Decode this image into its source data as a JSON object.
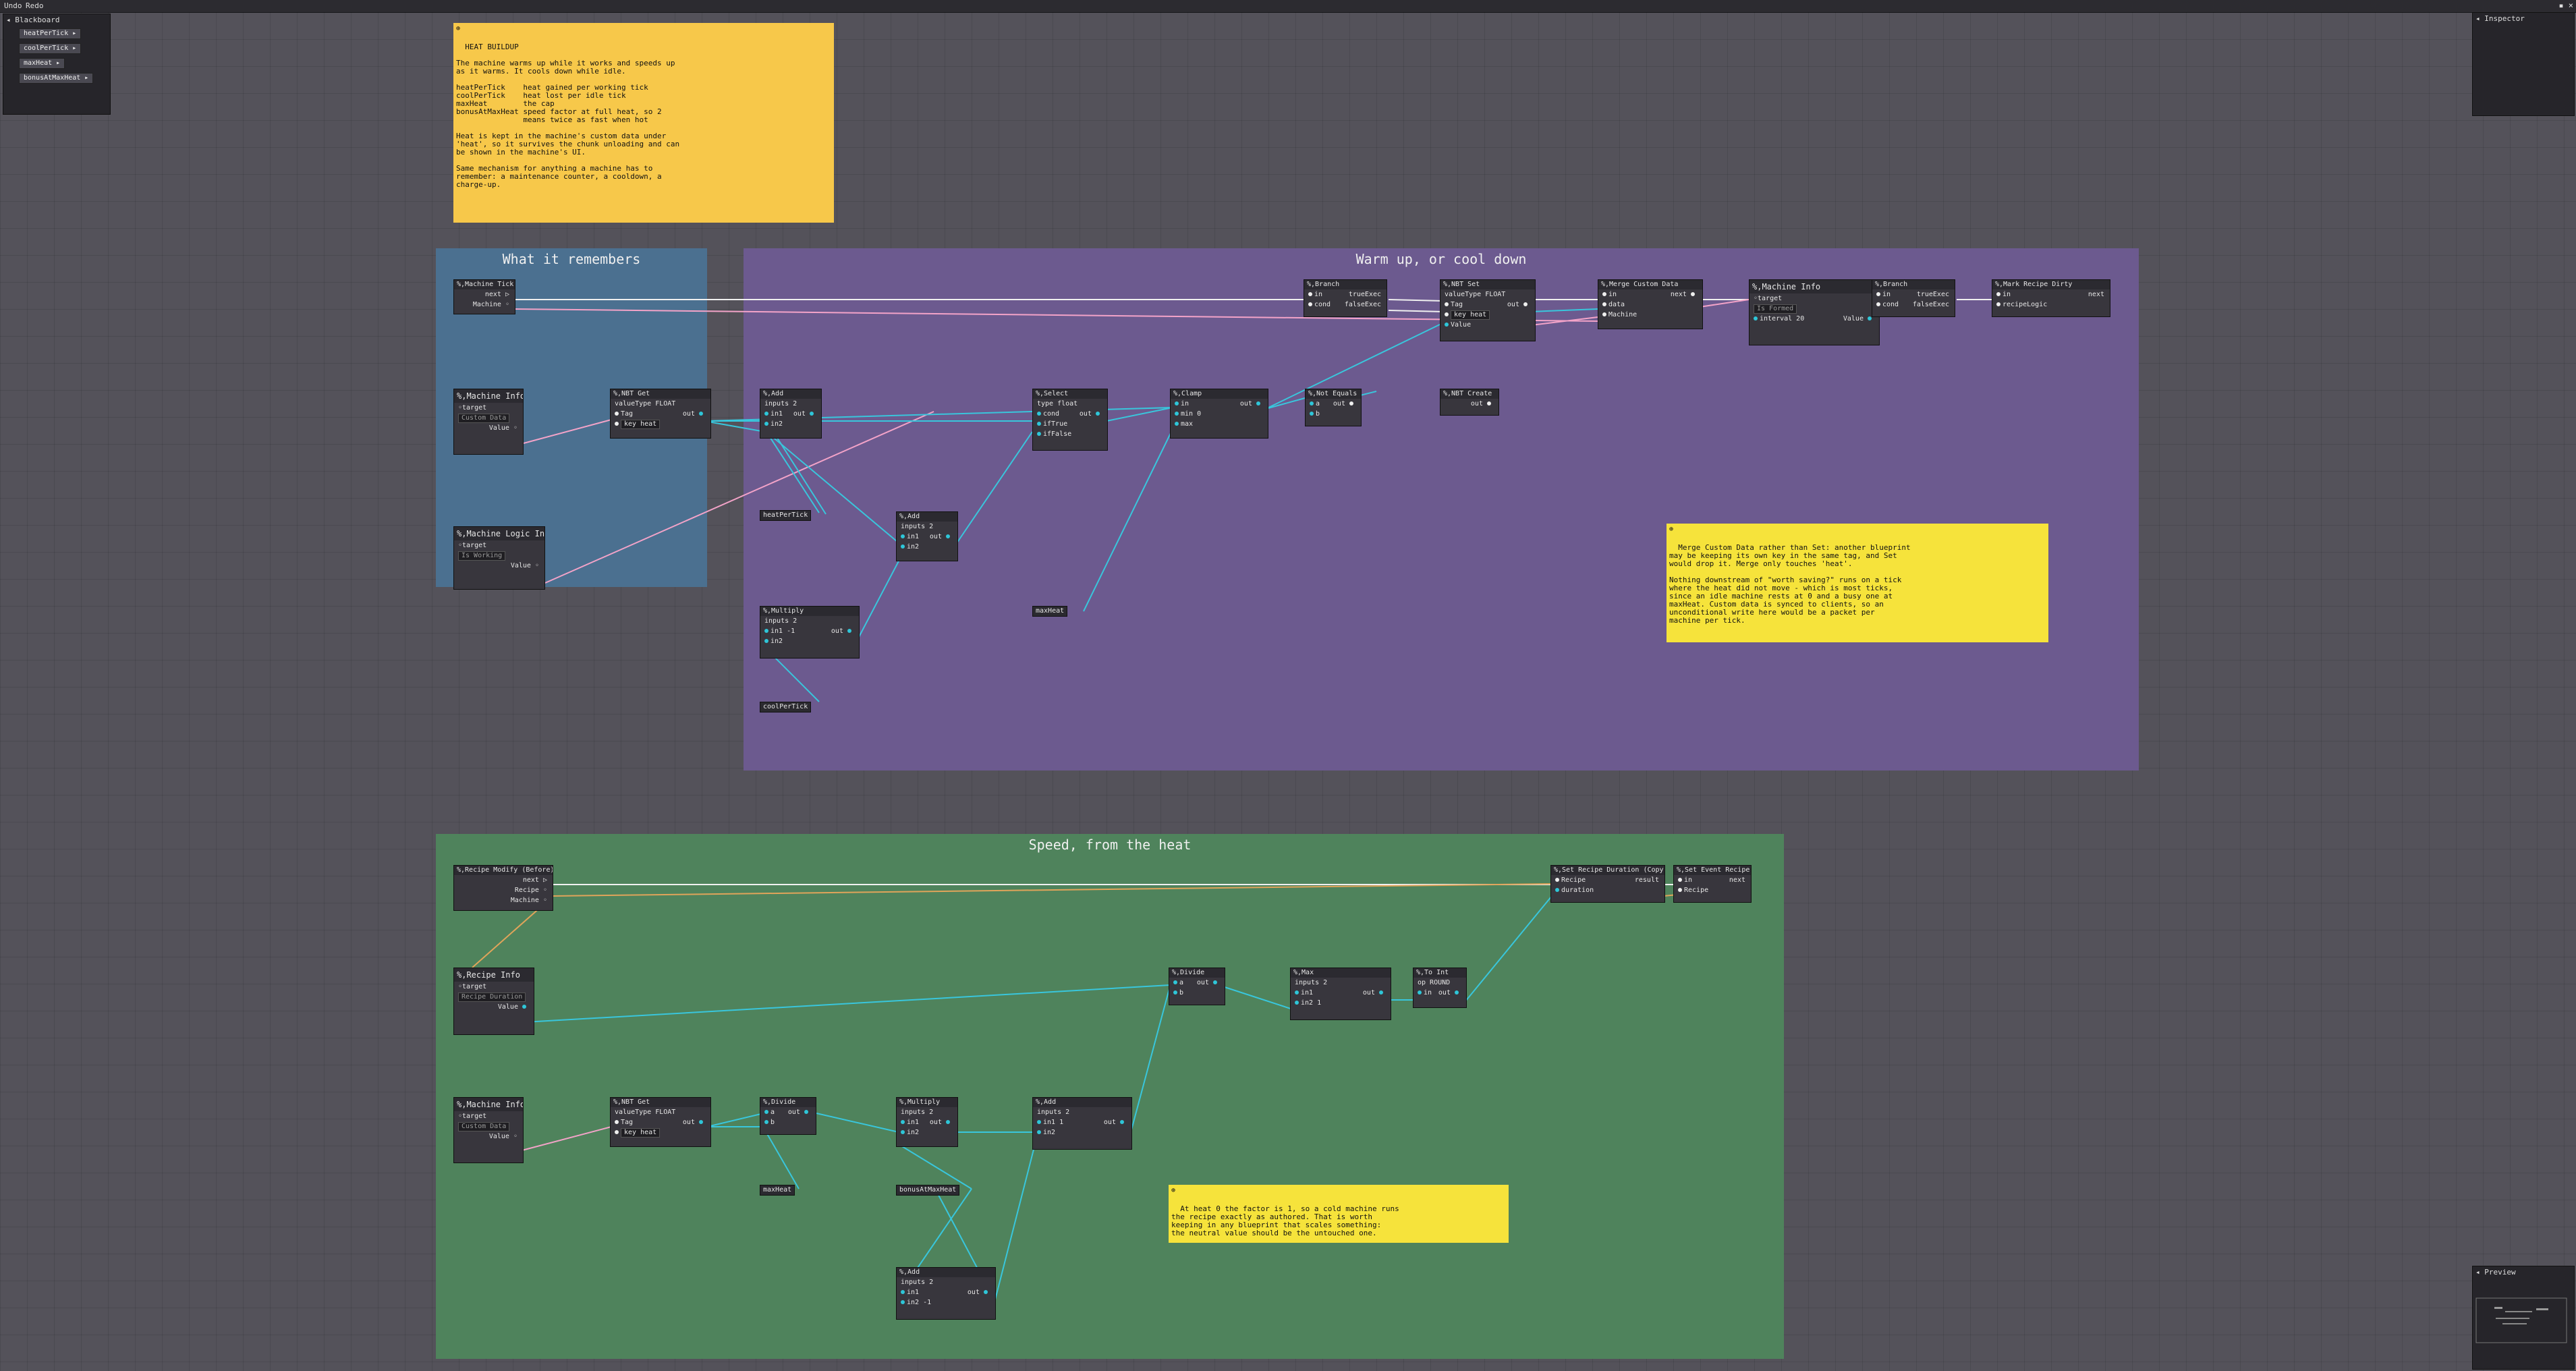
{
  "menu": {
    "undo": "Undo",
    "redo": "Redo"
  },
  "window": {
    "controls": "▪ ×"
  },
  "blackboard": {
    "title": "◂ Blackboard",
    "vars": [
      "heatPerTick ▸",
      "coolPerTick ▸",
      "maxHeat ▸",
      "bonusAtMaxHeat ▸"
    ]
  },
  "inspector": {
    "title": "◂ Inspector"
  },
  "preview": {
    "title": "◂ Preview"
  },
  "groups": {
    "remember": "What it remembers",
    "warm": "Warm up, or cool down",
    "speed": "Speed, from the heat"
  },
  "notes": {
    "heat": "HEAT BUILDUP\n\nThe machine warms up while it works and speeds up\nas it warms. It cools down while idle.\n\nheatPerTick    heat gained per working tick\ncoolPerTick    heat lost per idle tick\nmaxHeat        the cap\nbonusAtMaxHeat speed factor at full heat, so 2\n               means twice as fast when hot\n\nHeat is kept in the machine's custom data under\n'heat', so it survives the chunk unloading and can\nbe shown in the machine's UI.\n\nSame mechanism for anything a machine has to\nremember: a maintenance counter, a cooldown, a\ncharge-up.",
    "merge": "Merge Custom Data rather than Set: another blueprint\nmay be keeping its own key in the same tag, and Set\nwould drop it. Merge only touches 'heat'.\n\nNothing downstream of \"worth saving?\" runs on a tick\nwhere the heat did not move - which is most ticks,\nsince an idle machine rests at 0 and a busy one at\nmaxHeat. Custom data is synced to clients, so an\nunconditional write here would be a packet per\nmachine per tick.",
    "factor": "At heat 0 the factor is 1, so a cold machine runs\nthe recipe exactly as authored. That is worth\nkeeping in any blueprint that scales something:\nthe neutral value should be the untouched one."
  },
  "nodes": {
    "machineTick": {
      "title": "%,Machine Tick",
      "next": "next ▷",
      "machine": "Machine ◦"
    },
    "machineInfo1": {
      "title": "%,Machine Info",
      "target": "◦target",
      "field": "Custom Data",
      "value": "Value ◦"
    },
    "logicInfo": {
      "title": "%,Machine Logic Info",
      "target": "◦target",
      "field": "Is Working",
      "value": "Value ◦"
    },
    "nbtGet1": {
      "title": "%,NBT Get",
      "valueType": "valueType FLOAT",
      "tag": "Tag",
      "key": "key heat",
      "out": "out"
    },
    "add1": {
      "title": "%,Add",
      "inputs": "inputs 2",
      "in1": "in1",
      "in2": "in2",
      "out": "out"
    },
    "heatPerTick": {
      "title": "heatPerTick"
    },
    "add2": {
      "title": "%,Add",
      "inputs": "inputs 2",
      "in1": "in1",
      "in2": "in2",
      "out": "out"
    },
    "multiply1": {
      "title": "%,Multiply",
      "inputs": "inputs 2",
      "in1": "in1 -1",
      "in2": "in2",
      "out": "out"
    },
    "coolPerTick": {
      "title": "coolPerTick"
    },
    "select": {
      "title": "%,Select",
      "type": "type float",
      "cond": "cond",
      "ifTrue": "ifTrue",
      "ifFalse": "ifFalse",
      "out": "out"
    },
    "maxHeat1": {
      "title": "maxHeat"
    },
    "clamp": {
      "title": "%,Clamp",
      "in": "in",
      "min": "min 0",
      "max": "max",
      "out": "out"
    },
    "notEquals": {
      "title": "%,Not Equals",
      "a": "a",
      "b": "b",
      "out": "out"
    },
    "branch1": {
      "title": "%,Branch",
      "in": "in",
      "cond": "cond",
      "trueExec": "trueExec",
      "falseExec": "falseExec"
    },
    "nbtSet1": {
      "title": "%,NBT Set",
      "valueType": "valueType FLOAT",
      "tag": "Tag",
      "key": "key heat",
      "value": "Value",
      "out": "out"
    },
    "nbtCreate": {
      "title": "%,NBT Create",
      "out": "out"
    },
    "mergeCustom": {
      "title": "%,Merge Custom Data",
      "in": "in",
      "data": "data",
      "machine": "Machine",
      "next": "next"
    },
    "machineInfo2": {
      "title": "%,Machine Info",
      "target": "◦target",
      "field": "Is Formed",
      "interval": "interval 20",
      "value": "Value"
    },
    "branch2": {
      "title": "%,Branch",
      "in": "in",
      "cond": "cond",
      "trueExec": "trueExec",
      "falseExec": "falseExec"
    },
    "markDirty": {
      "title": "%,Mark Recipe Dirty",
      "in": "in",
      "recipeLogic": "recipeLogic",
      "next": "next"
    },
    "recipeModify": {
      "title": "%,Recipe Modify (Before)",
      "next": "next ▷",
      "recipe": "Recipe ◦",
      "machine": "Machine ◦"
    },
    "recipeInfo": {
      "title": "%,Recipe Info",
      "target": "◦target",
      "field": "Recipe Duration",
      "value": "Value"
    },
    "machineInfo3": {
      "title": "%,Machine Info",
      "target": "◦target",
      "field": "Custom Data",
      "value": "Value ◦"
    },
    "nbtGet2": {
      "title": "%,NBT Get",
      "valueType": "valueType FLOAT",
      "tag": "Tag",
      "key": "key heat",
      "out": "out"
    },
    "divide1": {
      "title": "%,Divide",
      "a": "a",
      "b": "b",
      "out": "out"
    },
    "maxHeat2": {
      "title": "maxHeat"
    },
    "multiply2": {
      "title": "%,Multiply",
      "inputs": "inputs 2",
      "in1": "in1",
      "in2": "in2",
      "out": "out"
    },
    "bonusAtMaxHeat": {
      "title": "bonusAtMaxHeat"
    },
    "add3": {
      "title": "%,Add",
      "inputs": "inputs 2",
      "in1": "in1",
      "in2": "in2 -1",
      "out": "out"
    },
    "add4": {
      "title": "%,Add",
      "inputs": "inputs 2",
      "in1": "in1 1",
      "in2": "in2",
      "out": "out"
    },
    "divide2": {
      "title": "%,Divide",
      "a": "a",
      "b": "b",
      "out": "out"
    },
    "max": {
      "title": "%,Max",
      "inputs": "inputs 2",
      "in1": "in1",
      "in2": "in2 1",
      "out": "out"
    },
    "toInt": {
      "title": "%,To Int",
      "mode": "op ROUND",
      "in": "in",
      "out": "out"
    },
    "setDuration": {
      "title": "%,Set Recipe Duration (Copy)",
      "recipe": "Recipe",
      "duration": "duration",
      "result": "result"
    },
    "setEventRecipe": {
      "title": "%,Set Event Recipe",
      "in": "in",
      "recipe": "Recipe",
      "next": "next"
    }
  }
}
